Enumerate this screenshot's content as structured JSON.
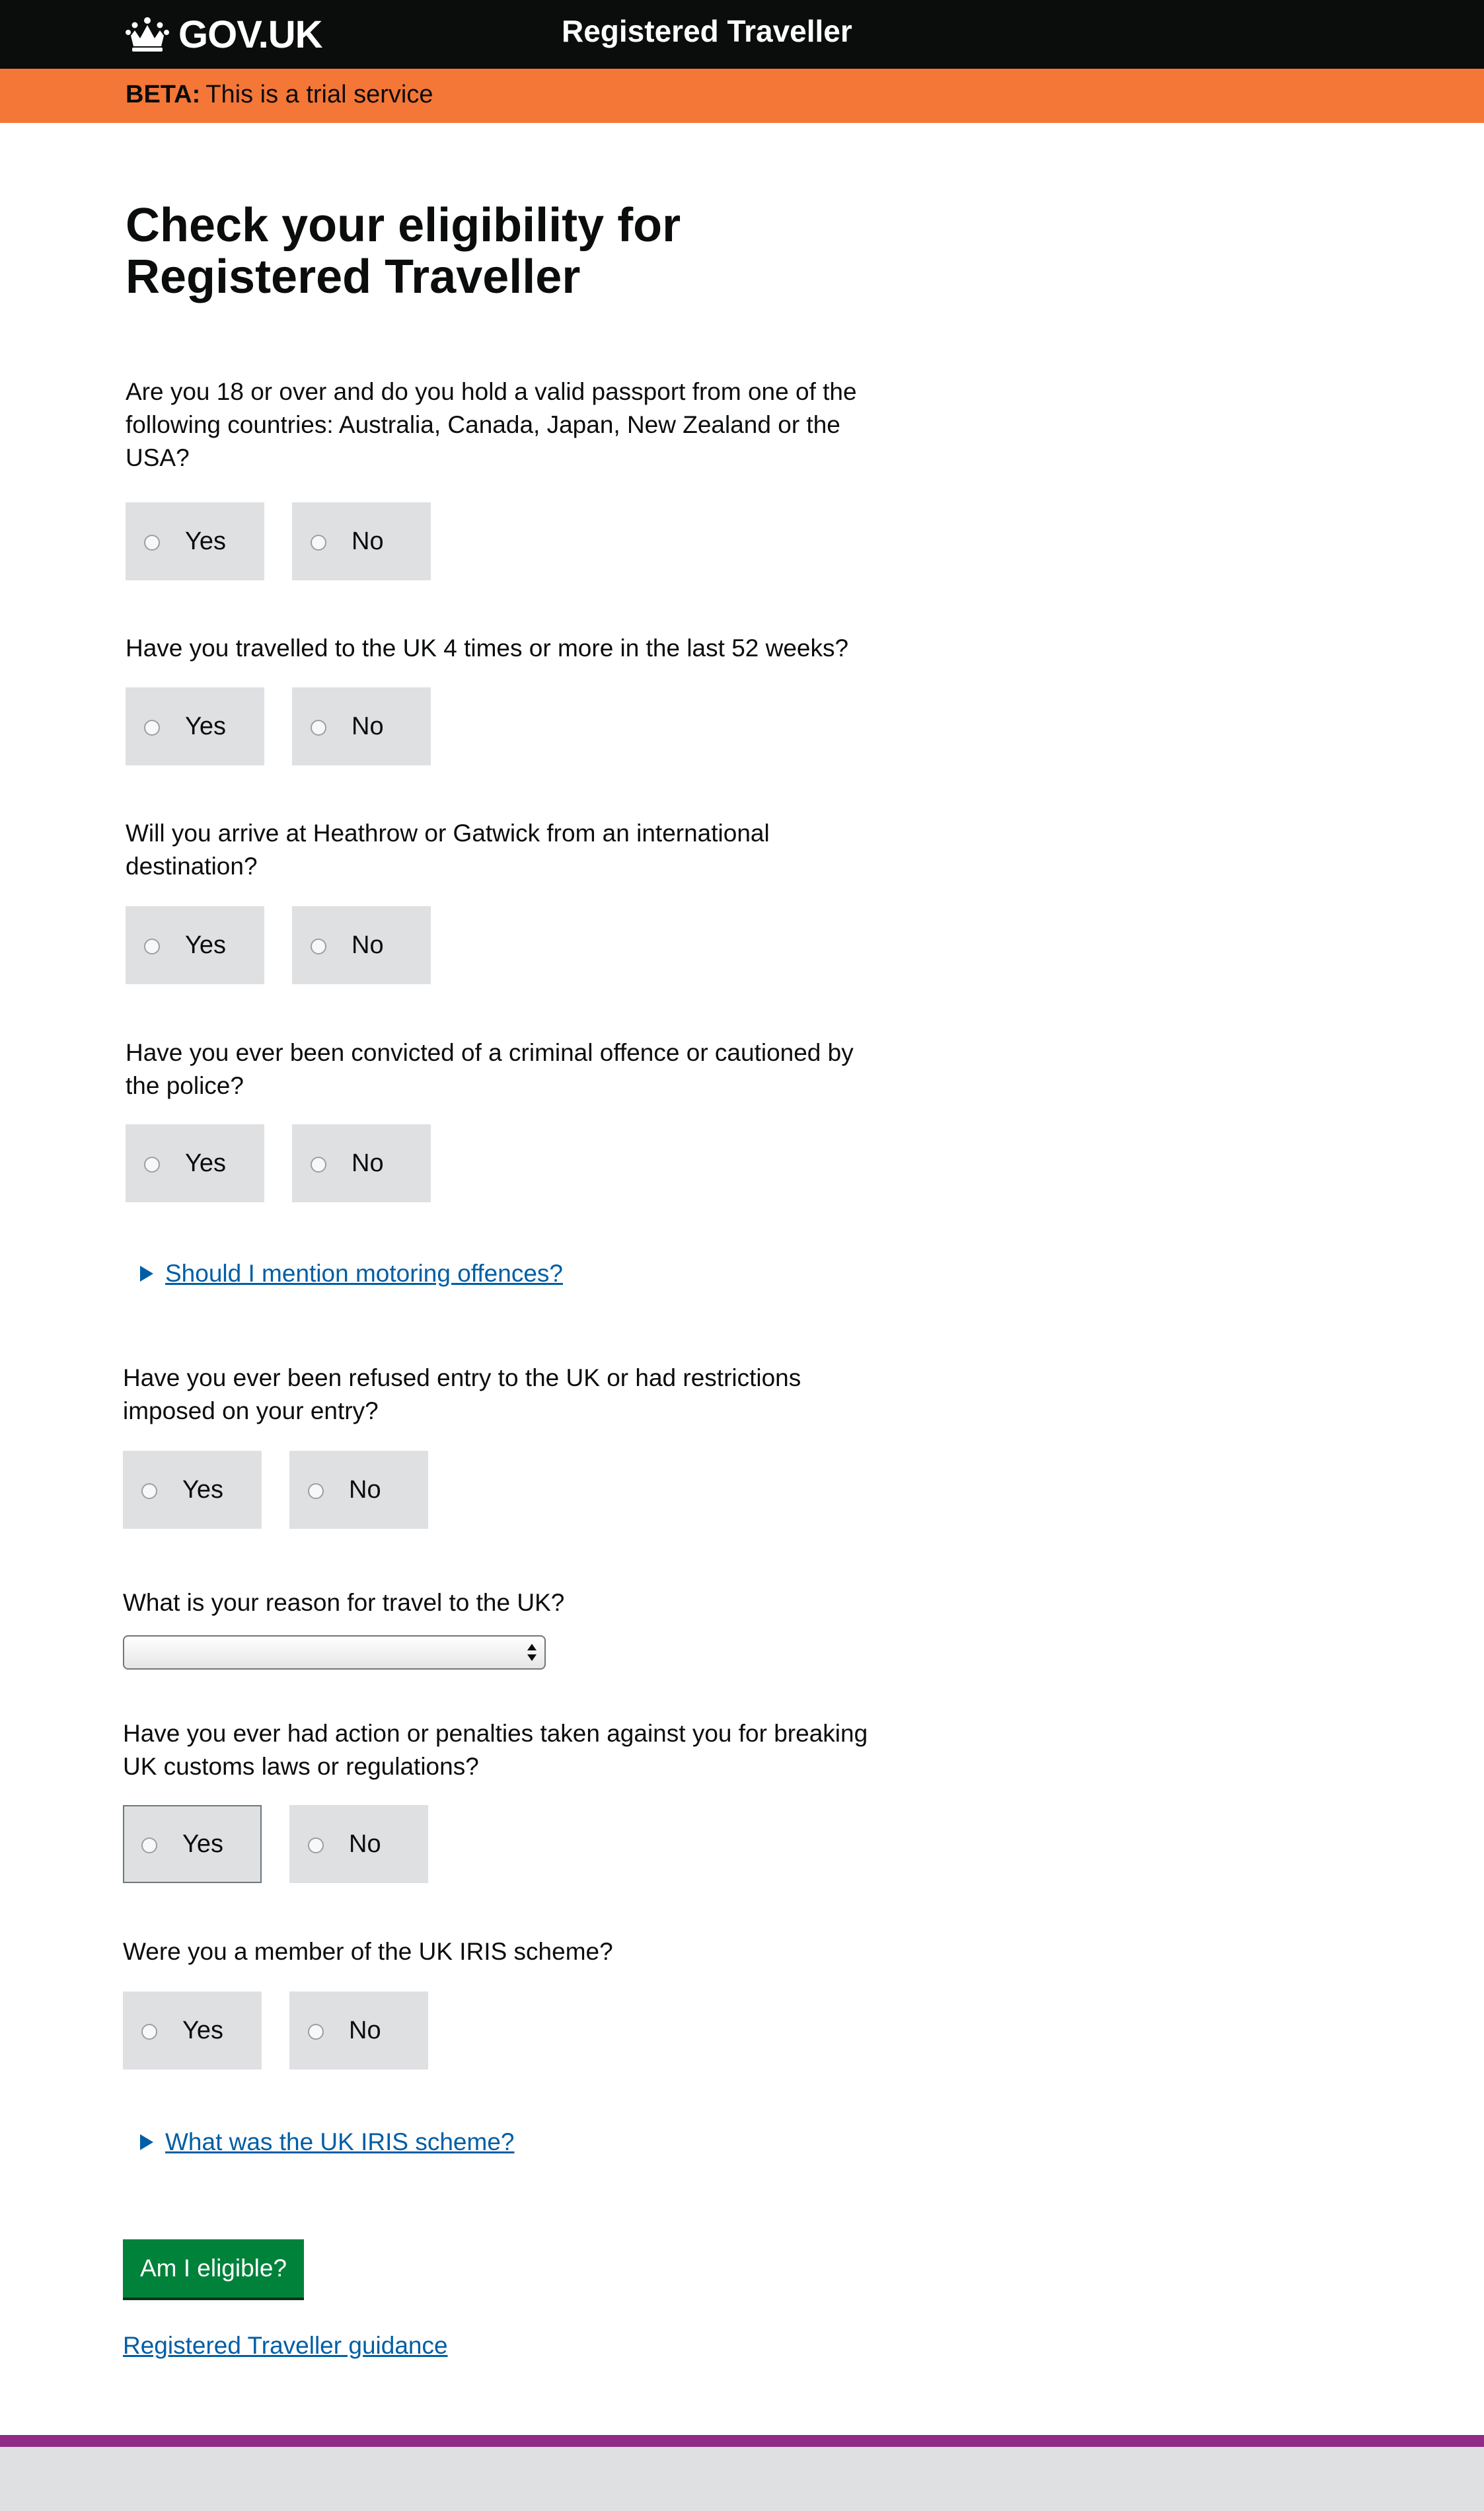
{
  "header": {
    "logo_text": "GOV.UK",
    "service_name": "Registered Traveller"
  },
  "beta": {
    "tag": "BETA:",
    "text": "This is a trial service"
  },
  "page": {
    "title": "Check your eligibility for Registered Traveller"
  },
  "questions": [
    {
      "text": "Are you 18 or over and do you hold a valid passport from one of the following countries: Australia, Canada, Japan, New Zealand or the USA?",
      "yes": "Yes",
      "no": "No"
    },
    {
      "text": "Have you travelled to the UK 4 times or more in the last 52 weeks?",
      "yes": "Yes",
      "no": "No"
    },
    {
      "text": "Will you arrive at Heathrow or Gatwick from an international destination?",
      "yes": "Yes",
      "no": "No"
    },
    {
      "text": "Have you ever been convicted of a criminal offence or cautioned by the police?",
      "yes": "Yes",
      "no": "No"
    },
    {
      "text": "Have you ever been refused entry to the UK or had restrictions imposed on your entry?",
      "yes": "Yes",
      "no": "No"
    },
    {
      "text": "What is your reason for travel to the UK?"
    },
    {
      "text": "Have you ever had action or penalties taken against you for breaking UK customs laws or regulations?",
      "yes": "Yes",
      "no": "No"
    },
    {
      "text": "Were you a member of the UK IRIS scheme?",
      "yes": "Yes",
      "no": "No"
    }
  ],
  "details": {
    "motoring": "Should I mention motoring offences?",
    "iris": "What was the UK IRIS scheme?"
  },
  "travel_reason_select": {
    "selected": ""
  },
  "submit_label": "Am I eligible?",
  "guidance_link": "Registered Traveller guidance",
  "colors": {
    "header": "#0b0c0c",
    "beta_banner": "#f47738",
    "radio_bg": "#dee0e2",
    "link": "#005ea5",
    "button": "#00823b",
    "footer_accent": "#912b88"
  },
  "icons": {
    "logo": "crown-icon",
    "details": "triangle-right-icon",
    "select": "up-down-arrows-icon"
  }
}
